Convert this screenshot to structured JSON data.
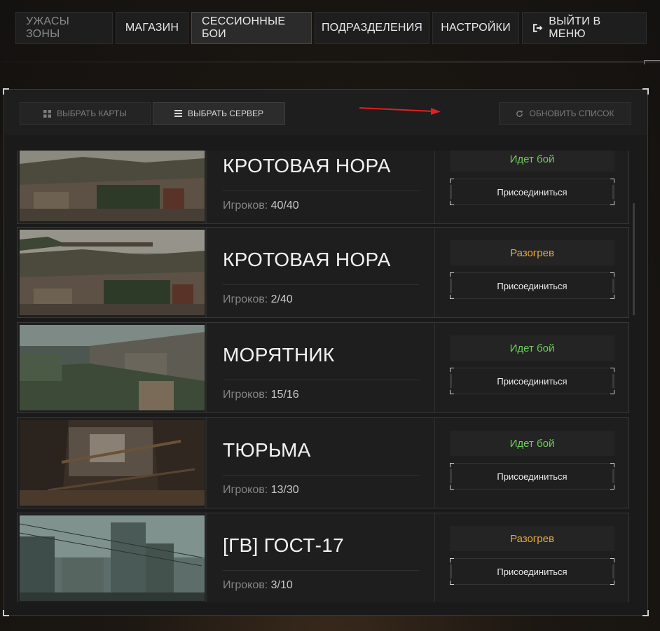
{
  "nav": {
    "tabs": [
      {
        "label": "УЖАСЫ ЗОНЫ",
        "state": "muted"
      },
      {
        "label": "МАГАЗИН",
        "state": "normal"
      },
      {
        "label": "СЕССИОННЫЕ БОИ",
        "state": "active"
      },
      {
        "label": "ПОДРАЗДЕЛЕНИЯ",
        "state": "normal"
      },
      {
        "label": "НАСТРОЙКИ",
        "state": "normal"
      }
    ],
    "exit_label": "ВЫЙТИ В МЕНЮ",
    "exit_icon": "exit-icon"
  },
  "toolbar": {
    "maps_label": "ВЫБРАТЬ КАРТЫ",
    "maps_icon": "grid-icon",
    "server_label": "ВЫБРАТЬ СЕРВЕР",
    "server_icon": "list-icon",
    "refresh_label": "ОБНОВИТЬ СПИСОК",
    "refresh_icon": "refresh-icon"
  },
  "servers": [
    {
      "map": "КРОТОВАЯ НОРА",
      "players_label": "Игроков:",
      "players": "40/40",
      "status": "Идет бой",
      "join_label": "Присоединиться",
      "scene": "industrial"
    },
    {
      "map": "КРОТОВАЯ НОРА",
      "players_label": "Игроков:",
      "players": "2/40",
      "status": "Разогрев",
      "join_label": "Присоединиться",
      "scene": "industrial"
    },
    {
      "map": "МОРЯТНИК",
      "players_label": "Игроков:",
      "players": "15/16",
      "status": "Идет бой",
      "join_label": "Присоединиться",
      "scene": "dam"
    },
    {
      "map": "ТЮРЬМА",
      "players_label": "Игроков:",
      "players": "13/30",
      "status": "Идет бой",
      "join_label": "Присоединиться",
      "scene": "interior"
    },
    {
      "map": "[ГВ] ГОСТ-17",
      "players_label": "Игроков:",
      "players": "3/10",
      "status": "Разогрев",
      "join_label": "Присоединиться",
      "scene": "city"
    }
  ],
  "colors": {
    "status_fighting": "#6fce5a",
    "status_warmup": "#e8a73c"
  }
}
